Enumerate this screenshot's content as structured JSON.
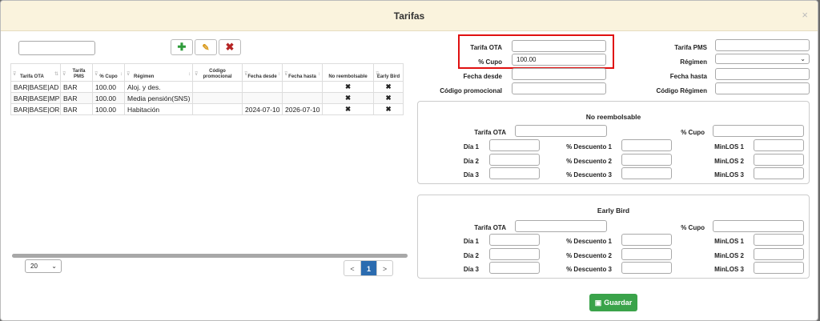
{
  "modal": {
    "title": "Tarifas",
    "close": "×"
  },
  "toolbar": {
    "add": "✚",
    "edit": "✎",
    "delete": "✖"
  },
  "search": {
    "value": ""
  },
  "table": {
    "headers": [
      "Tarifa OTA",
      "Tarifa PMS",
      "% Cupo",
      "Régimen",
      "Código promocional",
      "Fecha desde",
      "Fecha hasta",
      "No reembolsable",
      "Early Bird"
    ],
    "rows": [
      [
        "BAR|BASE|AD",
        "BAR",
        "100.00",
        "Aloj. y des.",
        "",
        "",
        "",
        "✖",
        "✖"
      ],
      [
        "BAR|BASE|MP",
        "BAR",
        "100.00",
        "Media pensión(SNS)",
        "",
        "",
        "",
        "✖",
        "✖"
      ],
      [
        "BAR|BASE|OR",
        "BAR",
        "100.00",
        "Habitación",
        "",
        "2024-07-10",
        "2026-07-10",
        "✖",
        "✖"
      ]
    ]
  },
  "pagination": {
    "page_size": "20",
    "prev": "<",
    "current": "1",
    "next": ">"
  },
  "form": {
    "labels": {
      "tarifa_ota": "Tarifa OTA",
      "cupo": "% Cupo",
      "fecha_desde": "Fecha desde",
      "codigo_promocional": "Código promocional",
      "tarifa_pms": "Tarifa PMS",
      "regimen": "Régimen",
      "fecha_hasta": "Fecha hasta",
      "codigo_regimen": "Código Régimen"
    },
    "values": {
      "tarifa_ota": "",
      "cupo": "100.00"
    }
  },
  "no_reembolsable": {
    "title": "No reembolsable",
    "tarifa_ota": "Tarifa OTA",
    "cupo": "% Cupo",
    "dia1": "Día 1",
    "dia2": "Día 2",
    "dia3": "Día 3",
    "desc1": "% Descuento 1",
    "desc2": "% Descuento 2",
    "desc3": "% Descuento 3",
    "minlos1": "MinLOS 1",
    "minlos2": "MinLOS 2",
    "minlos3": "MinLOS 3"
  },
  "early_bird": {
    "title": "Early Bird",
    "tarifa_ota": "Tarifa OTA",
    "cupo": "% Cupo",
    "dia1": "Día 1",
    "dia2": "Día 2",
    "dia3": "Día 3",
    "desc1": "% Descuento 1",
    "desc2": "% Descuento 2",
    "desc3": "% Descuento 3",
    "minlos1": "MinLOS 1",
    "minlos2": "MinLOS 2",
    "minlos3": "MinLOS 3"
  },
  "save": {
    "label": "Guardar"
  },
  "colors": {
    "highlight": "#e01010",
    "save": "#3aa34a",
    "delete": "#b52424",
    "add": "#2e9b3a",
    "active_page": "#2b6cb0"
  }
}
